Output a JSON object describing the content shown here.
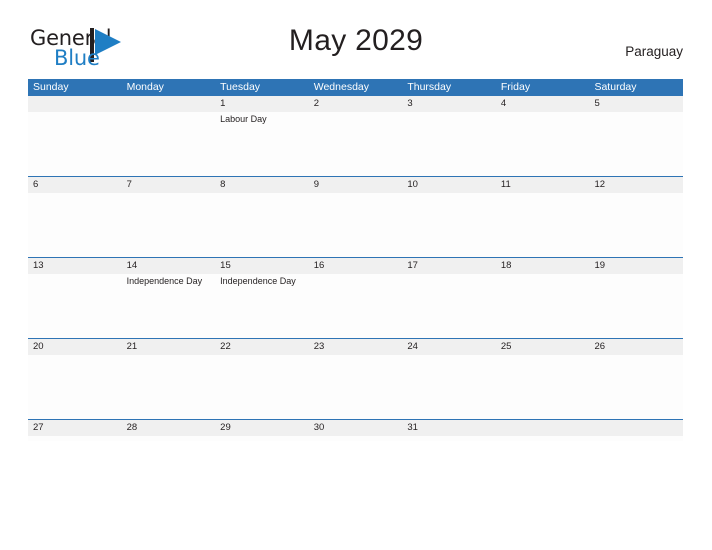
{
  "brand": {
    "name_part1": "General",
    "name_part2": "Blue",
    "flag_icon": "flag-triangle-icon",
    "dark_color": "#231f20",
    "blue_color": "#1f7ec4"
  },
  "header": {
    "title": "May 2029",
    "country": "Paraguay"
  },
  "theme": {
    "header_blue": "#2e74b5",
    "date_band_gray": "#f0f0f0",
    "rule_blue": "#2e74b5",
    "text_color": "#231f20",
    "cell_background": "#fdfdfd"
  },
  "calendar": {
    "weekdays": [
      "Sunday",
      "Monday",
      "Tuesday",
      "Wednesday",
      "Thursday",
      "Friday",
      "Saturday"
    ],
    "weeks": [
      {
        "days": [
          {
            "date": "",
            "event": ""
          },
          {
            "date": "",
            "event": ""
          },
          {
            "date": "1",
            "event": "Labour Day"
          },
          {
            "date": "2",
            "event": ""
          },
          {
            "date": "3",
            "event": ""
          },
          {
            "date": "4",
            "event": ""
          },
          {
            "date": "5",
            "event": ""
          }
        ]
      },
      {
        "days": [
          {
            "date": "6",
            "event": ""
          },
          {
            "date": "7",
            "event": ""
          },
          {
            "date": "8",
            "event": ""
          },
          {
            "date": "9",
            "event": ""
          },
          {
            "date": "10",
            "event": ""
          },
          {
            "date": "11",
            "event": ""
          },
          {
            "date": "12",
            "event": ""
          }
        ]
      },
      {
        "days": [
          {
            "date": "13",
            "event": ""
          },
          {
            "date": "14",
            "event": "Independence Day"
          },
          {
            "date": "15",
            "event": "Independence Day"
          },
          {
            "date": "16",
            "event": ""
          },
          {
            "date": "17",
            "event": ""
          },
          {
            "date": "18",
            "event": ""
          },
          {
            "date": "19",
            "event": ""
          }
        ]
      },
      {
        "days": [
          {
            "date": "20",
            "event": ""
          },
          {
            "date": "21",
            "event": ""
          },
          {
            "date": "22",
            "event": ""
          },
          {
            "date": "23",
            "event": ""
          },
          {
            "date": "24",
            "event": ""
          },
          {
            "date": "25",
            "event": ""
          },
          {
            "date": "26",
            "event": ""
          }
        ]
      },
      {
        "days": [
          {
            "date": "27",
            "event": ""
          },
          {
            "date": "28",
            "event": ""
          },
          {
            "date": "29",
            "event": ""
          },
          {
            "date": "30",
            "event": ""
          },
          {
            "date": "31",
            "event": ""
          },
          {
            "date": "",
            "event": ""
          },
          {
            "date": "",
            "event": ""
          }
        ]
      }
    ]
  }
}
